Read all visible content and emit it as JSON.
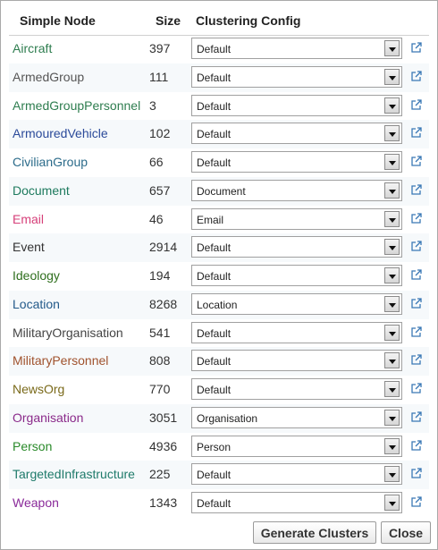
{
  "header": {
    "node_label": "Simple Node",
    "size_label": "Size",
    "config_label": "Clustering Config"
  },
  "rows": [
    {
      "name": "Aircraft",
      "size": "397",
      "config": "Default",
      "color": "#2e7d4f"
    },
    {
      "name": "ArmedGroup",
      "size": "111",
      "config": "Default",
      "color": "#555555"
    },
    {
      "name": "ArmedGroupPersonnel",
      "size": "3",
      "config": "Default",
      "color": "#2e7d4f"
    },
    {
      "name": "ArmouredVehicle",
      "size": "102",
      "config": "Default",
      "color": "#2b4a9a"
    },
    {
      "name": "CivilianGroup",
      "size": "66",
      "config": "Default",
      "color": "#2b6b8a"
    },
    {
      "name": "Document",
      "size": "657",
      "config": "Document",
      "color": "#1e7a5e"
    },
    {
      "name": "Email",
      "size": "46",
      "config": "Email",
      "color": "#d6407a"
    },
    {
      "name": "Event",
      "size": "2914",
      "config": "Default",
      "color": "#333333"
    },
    {
      "name": "Ideology",
      "size": "194",
      "config": "Default",
      "color": "#2f6f1e"
    },
    {
      "name": "Location",
      "size": "8268",
      "config": "Location",
      "color": "#235a8a"
    },
    {
      "name": "MilitaryOrganisation",
      "size": "541",
      "config": "Default",
      "color": "#444444"
    },
    {
      "name": "MilitaryPersonnel",
      "size": "808",
      "config": "Default",
      "color": "#a0522d"
    },
    {
      "name": "NewsOrg",
      "size": "770",
      "config": "Default",
      "color": "#7a6a1a"
    },
    {
      "name": "Organisation",
      "size": "3051",
      "config": "Organisation",
      "color": "#8a2a8a"
    },
    {
      "name": "Person",
      "size": "4936",
      "config": "Person",
      "color": "#2a8a2a"
    },
    {
      "name": "TargetedInfrastructure",
      "size": "225",
      "config": "Default",
      "color": "#1e7a6a"
    },
    {
      "name": "Weapon",
      "size": "1343",
      "config": "Default",
      "color": "#8a2a9a"
    }
  ],
  "icons": {
    "open": "external-link-icon",
    "dropdown": "chevron-down-icon"
  },
  "buttons": {
    "generate": "Generate Clusters",
    "close": "Close"
  }
}
